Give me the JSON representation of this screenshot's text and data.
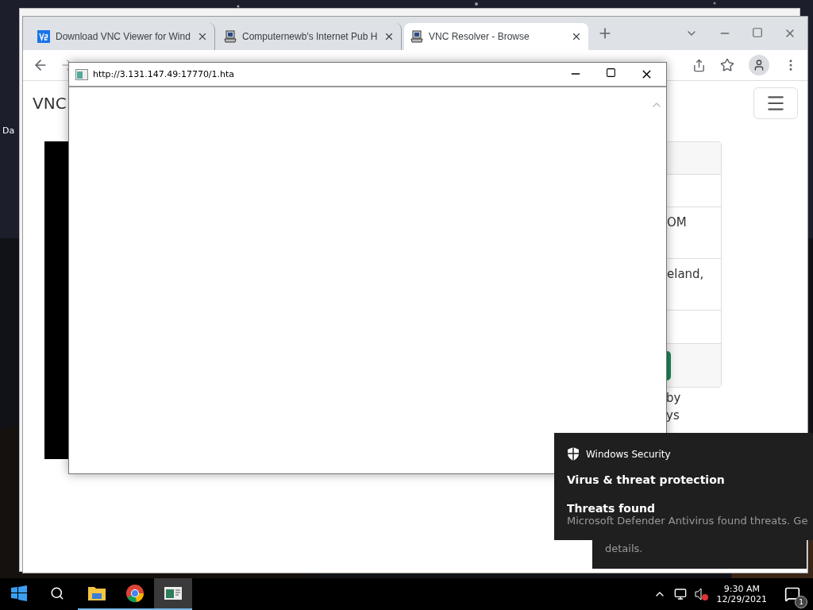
{
  "desktop": {
    "icon_label": "Da"
  },
  "browser": {
    "tabs": [
      {
        "title": "Download VNC Viewer for Wind",
        "kind": "vnc",
        "selected": false
      },
      {
        "title": "Computernewb's Internet Pub H",
        "kind": "computer",
        "selected": false
      },
      {
        "title": "VNC Resolver - Browse",
        "kind": "computer",
        "selected": true
      }
    ],
    "page": {
      "brand": "VNC",
      "card_texts": [
        "OM",
        "eland,"
      ],
      "below_texts": [
        "by",
        "ys"
      ]
    }
  },
  "popup": {
    "title": "http://3.131.147.49:17770/1.hta"
  },
  "toast": {
    "app": "Windows Security",
    "heading": "Virus & threat protection",
    "title": "Threats found",
    "body": "Microsoft Defender Antivirus found threats. Ge",
    "body_more": "details."
  },
  "taskbar": {
    "apps": [
      {
        "kind": "explorer",
        "running": true,
        "selected": false
      },
      {
        "kind": "chrome",
        "running": true,
        "selected": false
      },
      {
        "kind": "hta",
        "running": true,
        "selected": true
      }
    ],
    "time": "9:30 AM",
    "date": "12/29/2021",
    "notification_count": "1"
  }
}
